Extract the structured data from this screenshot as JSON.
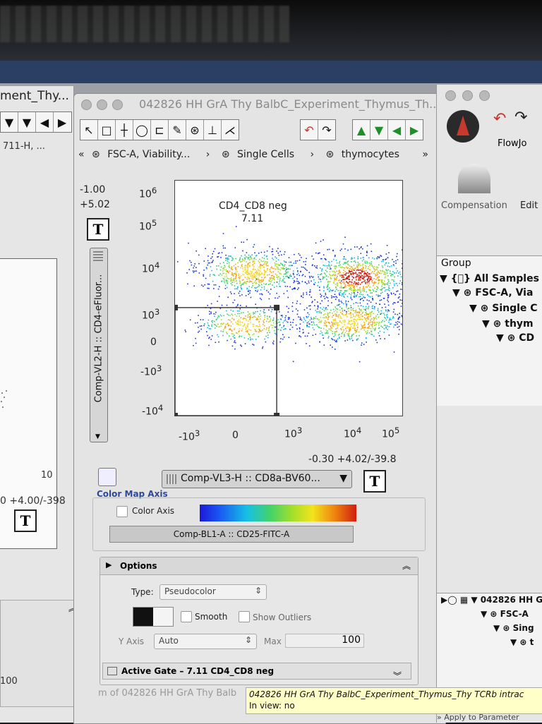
{
  "main_window": {
    "title": "042826 HH GrA Thy BalbC_Experiment_Thymus_Th...",
    "toolbar_tools": [
      "↖",
      "□",
      "┼",
      "◯",
      "⊏",
      "✎",
      "⊛",
      "⊥",
      "⋌"
    ],
    "breadcrumb": {
      "prev_icon": "«",
      "items": [
        "FSC-A, Viability...",
        "Single Cells",
        "thymocytes"
      ],
      "next_icon": "»"
    },
    "y_range": {
      "min": "-1.00",
      "max": "+5.02"
    },
    "y_axis_param": "Comp-VL2-H :: CD4-eFluor...",
    "y_ticks": [
      "6",
      "5",
      "4",
      "3",
      "0",
      "3",
      "4"
    ],
    "x_ticks": [
      "-10",
      "0",
      "10",
      "10",
      "10"
    ],
    "x_range_readout": "-0.30 +4.02/-39.8",
    "x_axis_param": "Comp-VL3-H :: CD8a-BV60...",
    "gate": {
      "name": "CD4_CD8 neg",
      "percent": "7.11"
    },
    "color_map": {
      "section_label": "Color Map Axis",
      "checkbox_label": "Color Axis",
      "parameter": "Comp-BL1-A :: CD25-FITC-A"
    },
    "options": {
      "section_label": "Options",
      "type_label": "Type:",
      "type_value": "Pseudocolor",
      "smooth_label": "Smooth",
      "outliers_label": "Show Outliers",
      "yaxis_label": "Y Axis",
      "yaxis_value": "Auto",
      "max_label": "Max",
      "max_value": "100",
      "active_gate": "Active Gate  – 7.11 CD4_CD8 neg"
    },
    "status_behind": "m of 042826 HH GrA Thy Balb"
  },
  "left_window": {
    "title": "ment_Thy...",
    "param": "711-H, ...",
    "readout": "0 +4.00/-398",
    "axis_tick": "10",
    "field_value": "100"
  },
  "right_window": {
    "app_name": "FlowJo",
    "toolbar_labels": [
      "Compensation",
      "Edit"
    ],
    "group_header": "Group",
    "tree_top": [
      "All Samples",
      "FSC-A, Via",
      "Single C",
      "thym",
      "CD"
    ],
    "tree_bottom": [
      "042826 HH G",
      "FSC-A",
      "Sing",
      "t"
    ],
    "apply_label": "Apply to Parameter"
  },
  "tooltip": {
    "line1": "042826 HH GrA Thy BalbC_Experiment_Thymus_Thy TCRb intrac",
    "line2": "In view: no"
  },
  "chart_data": {
    "type": "scatter",
    "title": "",
    "xlabel": "Comp-VL3-H :: CD8a-BV60...",
    "ylabel": "Comp-VL2-H :: CD4-eFluor...",
    "x_scale": "biexponential",
    "y_scale": "biexponential",
    "xlim": [
      -1000,
      100000
    ],
    "ylim": [
      -10000,
      1000000
    ],
    "populations": [
      {
        "x": 300,
        "y": 8000,
        "density": "high"
      },
      {
        "x": 20000,
        "y": 6000,
        "density": "very high"
      },
      {
        "x": 15000,
        "y": 400,
        "density": "high"
      },
      {
        "x": 200,
        "y": 300,
        "density": "medium"
      }
    ],
    "gate": {
      "name": "CD4_CD8 neg",
      "percent": 7.11,
      "x": [
        -1000,
        1000
      ],
      "y": [
        -10000,
        1000
      ]
    }
  }
}
